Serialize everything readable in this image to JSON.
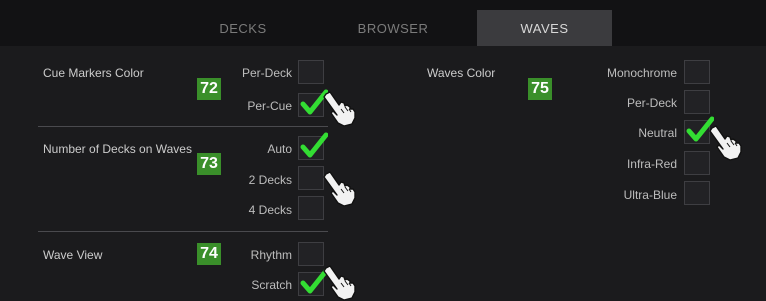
{
  "tabs": [
    {
      "label": "DECKS",
      "active": false
    },
    {
      "label": "BROWSER",
      "active": false
    },
    {
      "label": "WAVES",
      "active": true
    }
  ],
  "cue_markers": {
    "label": "Cue Markers Color",
    "badge": "72",
    "options": [
      {
        "label": "Per-Deck",
        "checked": false
      },
      {
        "label": "Per-Cue",
        "checked": true
      }
    ]
  },
  "decks_on_waves": {
    "label": "Number of Decks on Waves",
    "badge": "73",
    "options": [
      {
        "label": "Auto",
        "checked": true
      },
      {
        "label": "2 Decks",
        "checked": false
      },
      {
        "label": "4 Decks",
        "checked": false
      }
    ]
  },
  "wave_view": {
    "label": "Wave View",
    "badge": "74",
    "options": [
      {
        "label": "Rhythm",
        "checked": false
      },
      {
        "label": "Scratch",
        "checked": true
      }
    ]
  },
  "waves_color": {
    "label": "Waves Color",
    "badge": "75",
    "options": [
      {
        "label": "Monochrome",
        "checked": false
      },
      {
        "label": "Per-Deck",
        "checked": false
      },
      {
        "label": "Neutral",
        "checked": true
      },
      {
        "label": "Infra-Red",
        "checked": false
      },
      {
        "label": "Ultra-Blue",
        "checked": false
      }
    ]
  },
  "colors": {
    "badge": "#3a8f2a",
    "check": "#33dd33",
    "active_tab": "#3b3b3e"
  },
  "icons": [
    "checkmark-icon",
    "pointing-hand-icon"
  ]
}
